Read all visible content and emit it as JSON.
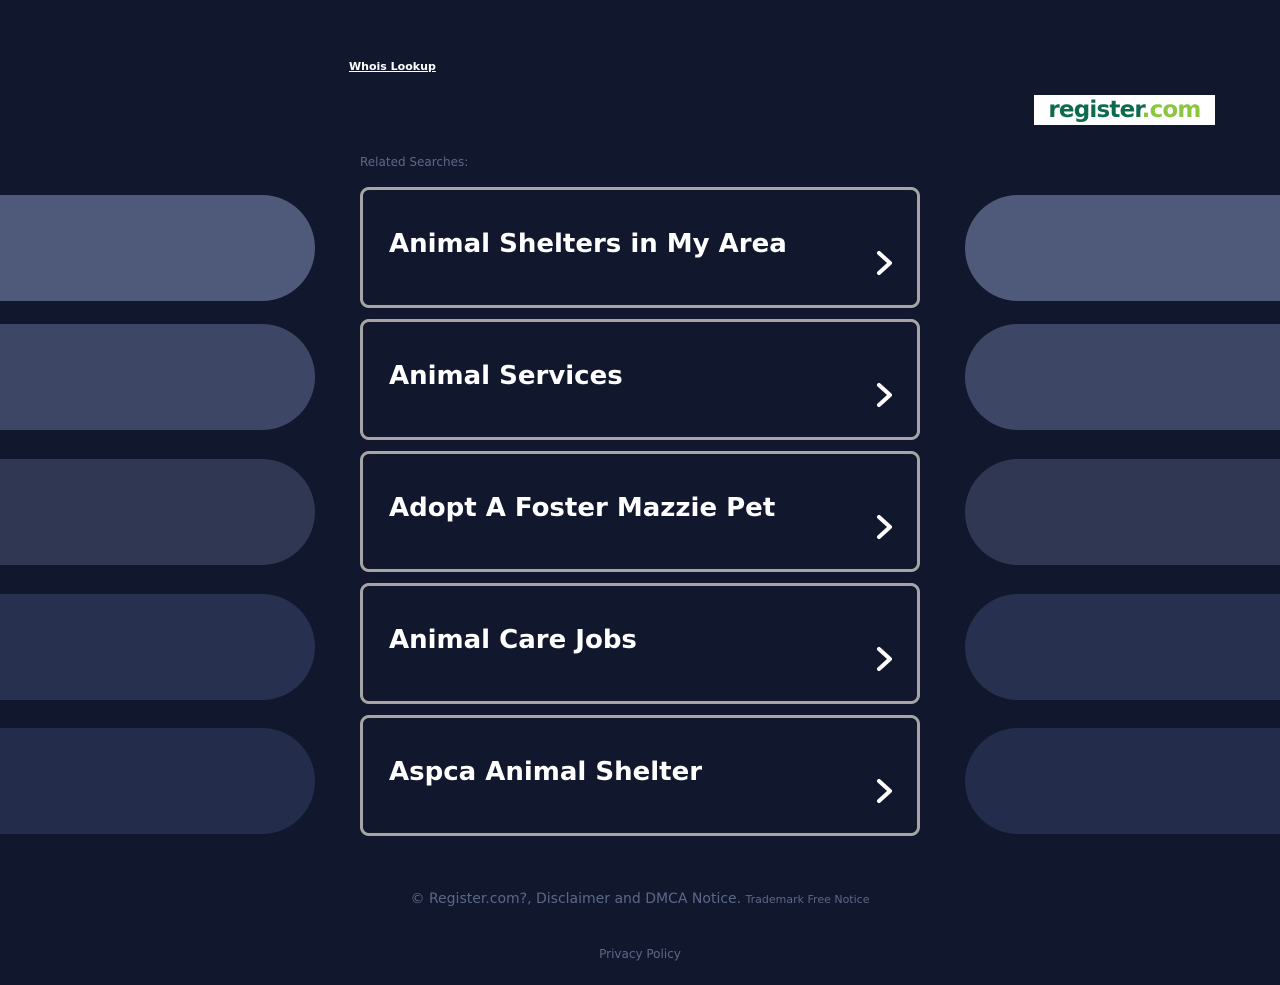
{
  "header": {
    "whois_link": "Whois Lookup"
  },
  "logo": {
    "text_primary": "register",
    "text_secondary": ".com",
    "primary_color": "#0e6a4e",
    "secondary_color": "#8cc63e"
  },
  "related": {
    "label": "Related Searches:",
    "items": [
      {
        "label": "Animal Shelters in My Area"
      },
      {
        "label": "Animal Services"
      },
      {
        "label": "Adopt A Foster Mazzie Pet"
      },
      {
        "label": "Animal Care Jobs"
      },
      {
        "label": "Aspca Animal Shelter"
      }
    ],
    "item_icon": "chevron-right-icon"
  },
  "side_decoration": {
    "colors": [
      "#4f5979",
      "#3d4665",
      "#2f3752",
      "#27304f",
      "#232c4b"
    ]
  },
  "footer": {
    "copyright": "© Register.com?, Disclaimer and DMCA Notice.",
    "trademark": "Trademark Free Notice",
    "privacy": "Privacy Policy"
  },
  "colors": {
    "background": "#11172c",
    "card_border": "#a5a5a5",
    "muted_text": "#5c6788"
  }
}
